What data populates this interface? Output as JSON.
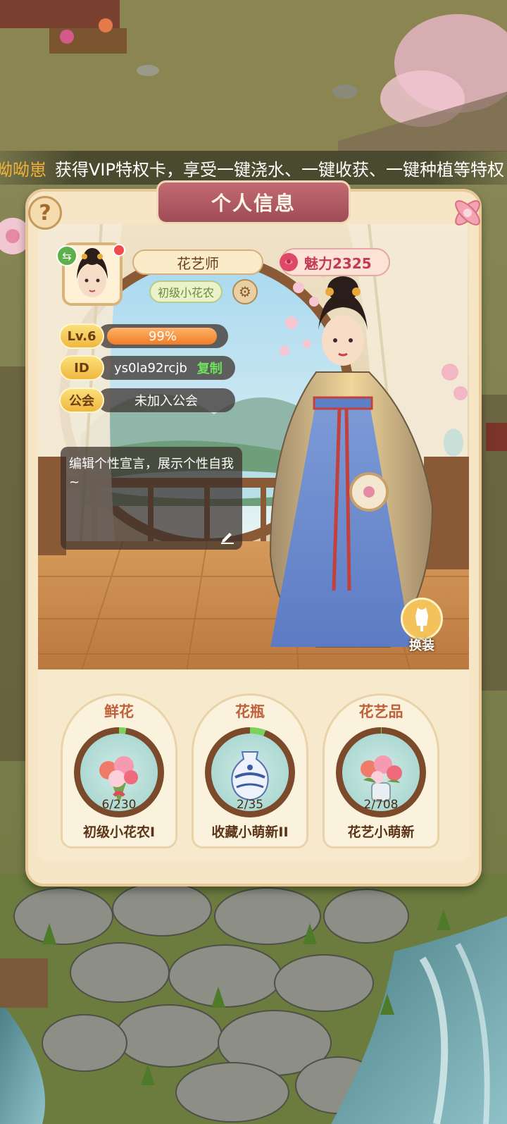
{
  "marquee": {
    "user": "呦呦崽",
    "message": "获得VIP特权卡，享受一键浇水、一键收获、一键种植等特权"
  },
  "panel": {
    "title": "个人信息"
  },
  "profile": {
    "name": "花艺师",
    "title_tag": "初级小花农",
    "charm_label": "魅力2325",
    "level_label": "Lv.6",
    "level_progress_text": "99%",
    "level_progress": 0.99,
    "id_label": "ID",
    "id_value": "ys0la92rcjb",
    "copy_label": "复制",
    "guild_label": "公会",
    "guild_value": "未加入公会",
    "motto_placeholder": "编辑个性宣言，展示个性自我~"
  },
  "actions": {
    "change_outfit": "换装"
  },
  "collections": [
    {
      "category": "鲜花",
      "count": "6/230",
      "rank": "初级小花农I",
      "progress": 0.026
    },
    {
      "category": "花瓶",
      "count": "2/35",
      "rank": "收藏小萌新II",
      "progress": 0.057
    },
    {
      "category": "花艺品",
      "count": "2/708",
      "rank": "花艺小萌新",
      "progress": 0.003
    }
  ],
  "colors": {
    "accent": "#f07c25",
    "title_plate": "#a8525c",
    "copy": "#6ee05a",
    "charm": "#c23a54"
  }
}
